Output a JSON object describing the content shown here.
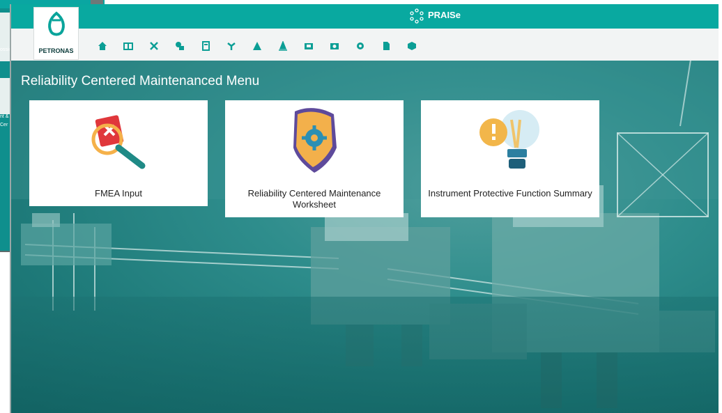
{
  "window": {
    "app_title": "PRAISe"
  },
  "brand": {
    "name": "PETRONAS"
  },
  "toolbar": {
    "icons": [
      "home-icon",
      "layout-icon",
      "tools-icon",
      "equipment-icon",
      "calculator-icon",
      "network-icon",
      "warning-icon",
      "cone-icon",
      "report-icon",
      "gauge-icon",
      "settings-icon",
      "document-icon",
      "cube-icon"
    ]
  },
  "page": {
    "title": "Reliability Centered Maintenanced Menu"
  },
  "cards": [
    {
      "label": "FMEA Input"
    },
    {
      "label": "Reliability Centered Maintenance Worksheet"
    },
    {
      "label": "Instrument Protective Function Summary"
    }
  ],
  "background_window": {
    "text_1": "ossic",
    "text_2": "nt &",
    "text_3": "Cer"
  },
  "colors": {
    "topbar": "#09a9a0",
    "toolbar_icon": "#0b9e95",
    "ocean": "#1f7f80"
  }
}
